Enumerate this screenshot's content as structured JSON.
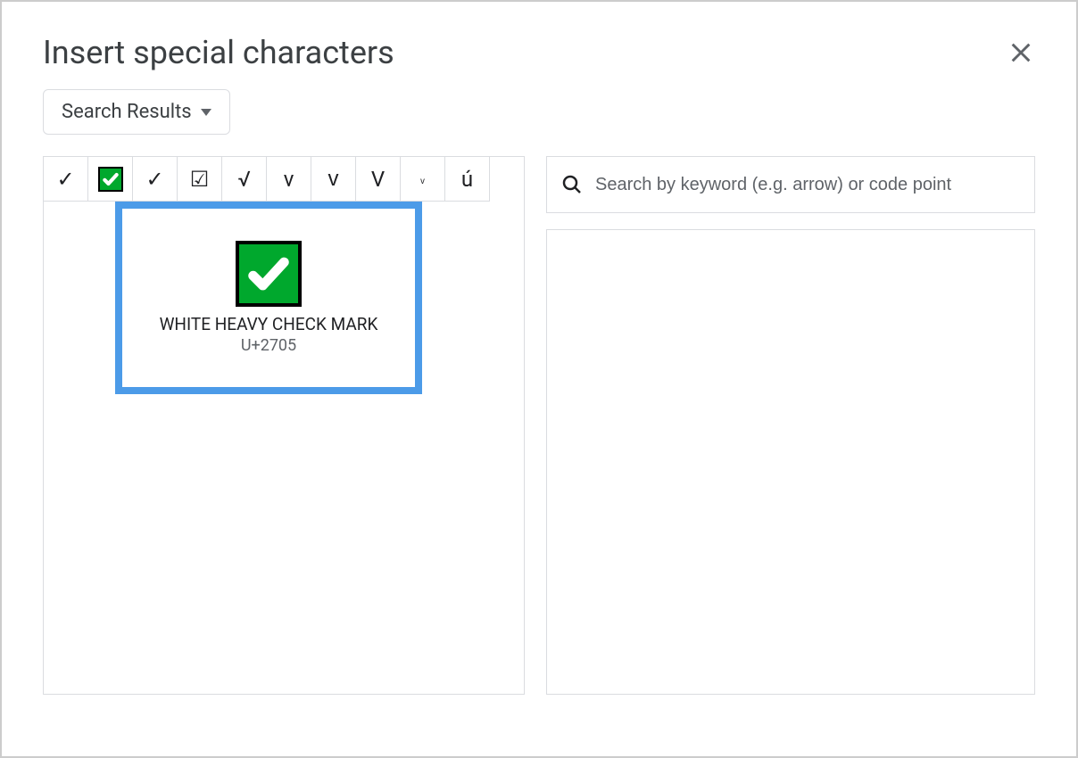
{
  "dialog": {
    "title": "Insert special characters"
  },
  "dropdown": {
    "label": "Search Results"
  },
  "chars": [
    {
      "glyph": "✓",
      "name": "check-mark"
    },
    {
      "glyph": "✅",
      "name": "white-heavy-check-mark",
      "special": "green"
    },
    {
      "glyph": "✓",
      "name": "heavy-check-mark"
    },
    {
      "glyph": "☑",
      "name": "ballot-box-check"
    },
    {
      "glyph": "√",
      "name": "square-root"
    },
    {
      "glyph": "v",
      "name": "latin-v-1"
    },
    {
      "glyph": "ᴠ",
      "name": "latin-v-2"
    },
    {
      "glyph": "V",
      "name": "latin-cap-v"
    },
    {
      "glyph": "ᵥ",
      "name": "latin-sub-v"
    },
    {
      "glyph": "ú",
      "name": "latin-u-acute"
    }
  ],
  "preview": {
    "name": "WHITE HEAVY CHECK MARK",
    "code": "U+2705"
  },
  "search": {
    "placeholder": "Search by keyword (e.g. arrow) or code point"
  }
}
